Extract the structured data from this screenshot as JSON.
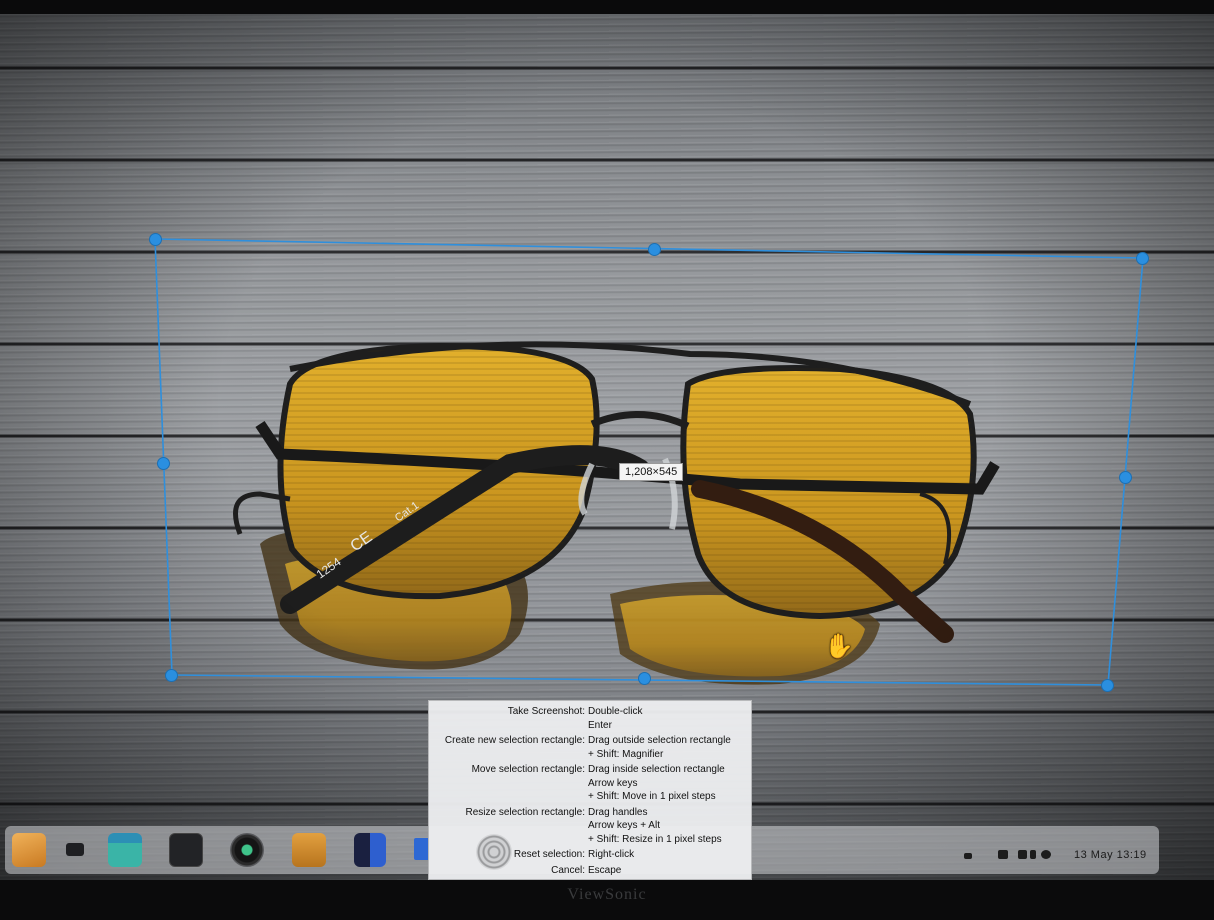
{
  "selection": {
    "size_label": "1,208×545"
  },
  "glasses": {
    "temple_print_left": "1254",
    "temple_print_mark": "CE",
    "temple_print_right": "Cat.1"
  },
  "help": {
    "rows": [
      {
        "key": "Take Screenshot:",
        "values": [
          "Double-click",
          "Enter"
        ]
      },
      {
        "key": "Create new selection rectangle:",
        "values": [
          "Drag outside selection rectangle",
          "+ Shift: Magnifier"
        ]
      },
      {
        "key": "Move selection rectangle:",
        "values": [
          "Drag inside selection rectangle",
          "Arrow keys",
          "+ Shift: Move in 1 pixel steps"
        ]
      },
      {
        "key": "Resize selection rectangle:",
        "values": [
          "Drag handles",
          "Arrow keys + Alt",
          "+ Shift: Resize in 1 pixel steps"
        ]
      },
      {
        "key": "Reset selection:",
        "values": [
          "Right-click"
        ]
      },
      {
        "key": "Cancel:",
        "values": [
          "Escape"
        ]
      }
    ]
  },
  "taskbar": {
    "icons": [
      "folder-icon",
      "terminal-small-icon",
      "file-manager-icon",
      "terminal-icon",
      "camera-icon",
      "archive-icon",
      "code-editor-icon",
      "document-icon"
    ],
    "clock": "13 May 13:19"
  },
  "monitor": {
    "brand": "ViewSonic"
  },
  "colors": {
    "selection_handle": "#2a8fe0",
    "selection_border": "#2f8fdc",
    "lens_tint": "#d9a21b"
  }
}
